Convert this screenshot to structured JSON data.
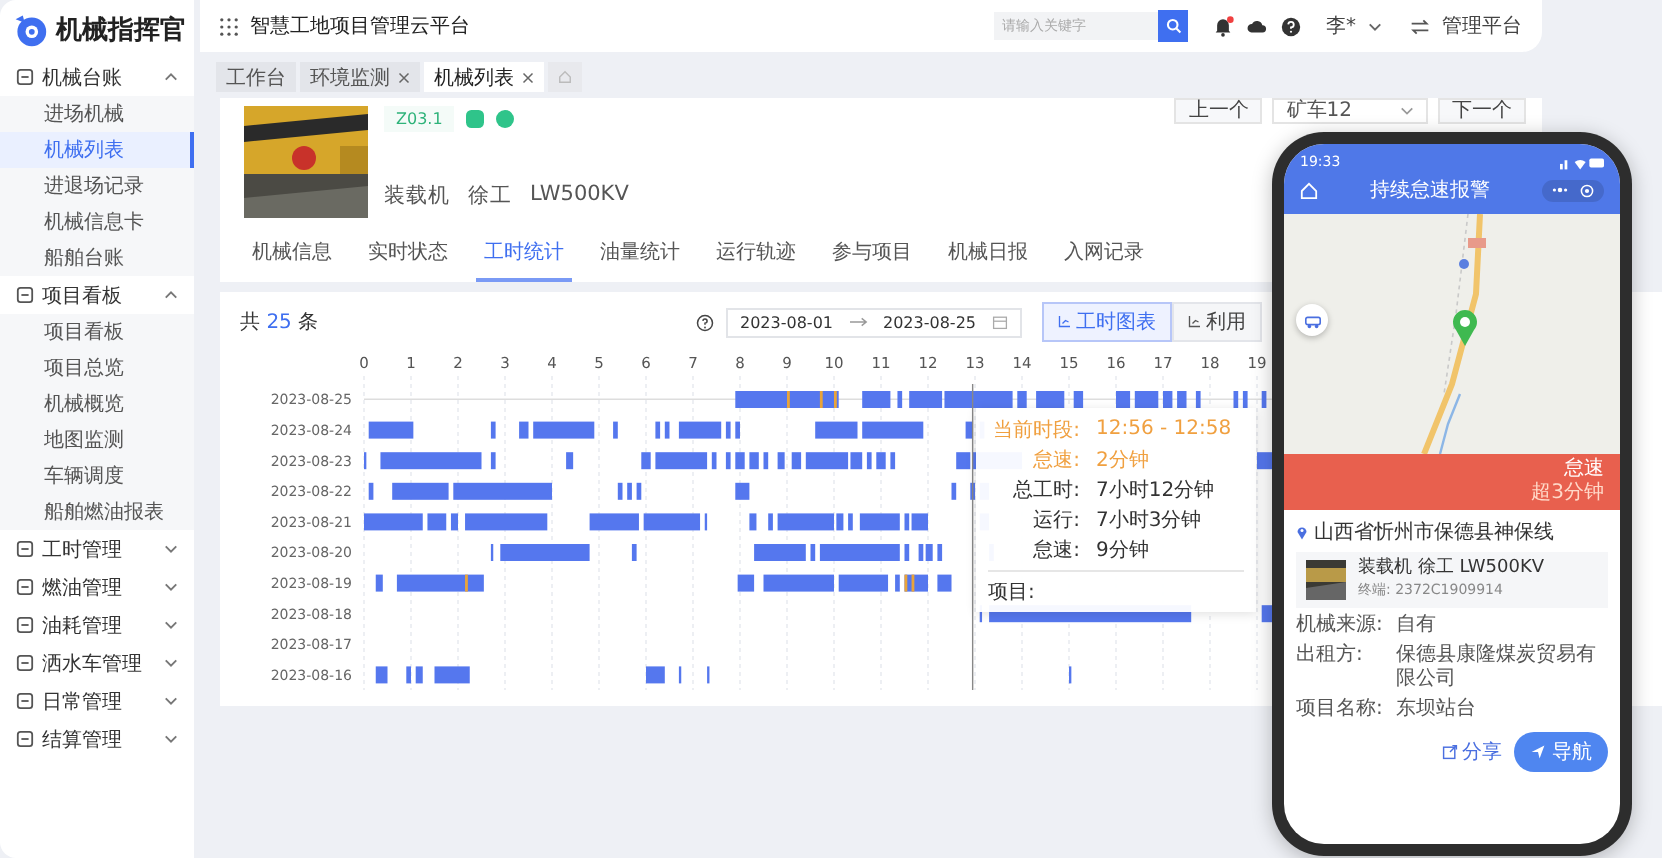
{
  "sidebar": {
    "logo": "机械指挥官",
    "groups": [
      {
        "label": "机械台账",
        "expanded": true,
        "children": [
          {
            "label": "进场机械",
            "selected": false
          },
          {
            "label": "机械列表",
            "selected": true
          },
          {
            "label": "进退场记录",
            "selected": false
          },
          {
            "label": "机械信息卡",
            "selected": false
          },
          {
            "label": "船舶台账",
            "selected": false
          }
        ]
      },
      {
        "label": "项目看板",
        "expanded": true,
        "children": [
          {
            "label": "项目看板",
            "selected": false
          },
          {
            "label": "项目总览",
            "selected": false
          },
          {
            "label": "机械概览",
            "selected": false
          },
          {
            "label": "地图监测",
            "selected": false
          },
          {
            "label": "车辆调度",
            "selected": false
          },
          {
            "label": "船舶燃油报表",
            "selected": false
          }
        ]
      },
      {
        "label": "工时管理",
        "expanded": false
      },
      {
        "label": "燃油管理",
        "expanded": false
      },
      {
        "label": "油耗管理",
        "expanded": false
      },
      {
        "label": "洒水车管理",
        "expanded": false
      },
      {
        "label": "日常管理",
        "expanded": false
      },
      {
        "label": "结算管理",
        "expanded": false
      }
    ]
  },
  "topbar": {
    "title": "智慧工地项目管理云平台",
    "search": {
      "placeholder": "请输入关键字"
    },
    "notification_dot": true,
    "user": "李*",
    "switch_label": "管理平台"
  },
  "page_tabs": [
    {
      "label": "工作台",
      "selected": false,
      "closable": false
    },
    {
      "label": "环境监测",
      "selected": false,
      "closable": true
    },
    {
      "label": "机械列表",
      "selected": true,
      "closable": true
    }
  ],
  "machine": {
    "code": "Z03.1",
    "title": [
      "装载机",
      "徐工",
      "LW500KV"
    ],
    "prev_button": "上一个",
    "select_value": "矿车12",
    "next_button": "下一个"
  },
  "detail_tabs": [
    {
      "label": "机械信息",
      "selected": false
    },
    {
      "label": "实时状态",
      "selected": false
    },
    {
      "label": "工时统计",
      "selected": true
    },
    {
      "label": "油量统计",
      "selected": false
    },
    {
      "label": "运行轨迹",
      "selected": false
    },
    {
      "label": "参与项目",
      "selected": false
    },
    {
      "label": "机械日报",
      "selected": false
    },
    {
      "label": "入网记录",
      "selected": false
    }
  ],
  "stats": {
    "total_prefix": "共",
    "total": "25",
    "total_suffix": "条",
    "date_from": "2023-08-01",
    "date_to": "2023-08-25",
    "views": [
      {
        "label": "工时图表",
        "selected": true
      },
      {
        "label": "利用",
        "selected": false
      }
    ]
  },
  "timeline": {
    "hours": [
      "0",
      "1",
      "2",
      "3",
      "4",
      "5",
      "6",
      "7",
      "8",
      "9",
      "10",
      "11",
      "12",
      "13",
      "14",
      "15",
      "16",
      "17",
      "18",
      "19"
    ],
    "dates": [
      "2023-08-25",
      "2023-08-24",
      "2023-08-23",
      "2023-08-22",
      "2023-08-21",
      "2023-08-20",
      "2023-08-19",
      "2023-08-18",
      "2023-08-17",
      "2023-08-16"
    ]
  },
  "tooltip": {
    "rows": [
      {
        "kind": "highlight",
        "label": "当前时段:",
        "value": "12:56 - 12:58"
      },
      {
        "kind": "highlight",
        "label": "怠速:",
        "value": "2分钟"
      },
      {
        "kind": "normal",
        "label": "总工时:",
        "value": "7小时12分钟"
      },
      {
        "kind": "normal",
        "label": "运行:",
        "value": "7小时3分钟"
      },
      {
        "kind": "normal",
        "label": "怠速:",
        "value": "9分钟"
      },
      {
        "kind": "project",
        "label": "项目:"
      }
    ]
  },
  "phone": {
    "time": "19:33",
    "title": "持续怠速报警",
    "banner": {
      "status": "怠速",
      "duration": "超3分钟"
    },
    "address": "山西省忻州市保德县神保线",
    "machine_name": "装载机 徐工 LW500KV",
    "terminal": "终端: 2372C1909914",
    "fields": [
      {
        "label": "机械来源:",
        "value": "自有"
      },
      {
        "label": "出租方:",
        "value": "保德县康隆煤炭贸易有限公司"
      },
      {
        "label": "项目名称:",
        "value": "东坝站台"
      }
    ],
    "share": "分享",
    "navigate": "导航"
  }
}
